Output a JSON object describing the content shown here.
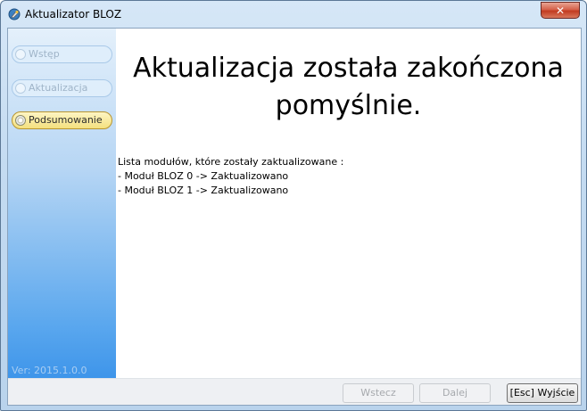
{
  "window": {
    "title": "Aktualizator BLOZ",
    "close_label": "✕"
  },
  "sidebar": {
    "steps": [
      {
        "label": "Wstęp",
        "state": "disabled"
      },
      {
        "label": "Aktualizacja",
        "state": "disabled"
      },
      {
        "label": "Podsumowanie",
        "state": "active"
      }
    ],
    "version": "Ver: 2015.1.0.0"
  },
  "content": {
    "headline": "Aktualizacja została zakończona pomyślnie.",
    "modules_header": "Lista modułów, które zostały zaktualizowane :",
    "modules": [
      "- Moduł BLOZ 0 -> Zaktualizowano",
      "- Moduł BLOZ 1 -> Zaktualizowano"
    ]
  },
  "footer": {
    "back_label": "Wstecz",
    "next_label": "Dalej",
    "exit_label": "[Esc] Wyjście"
  }
}
